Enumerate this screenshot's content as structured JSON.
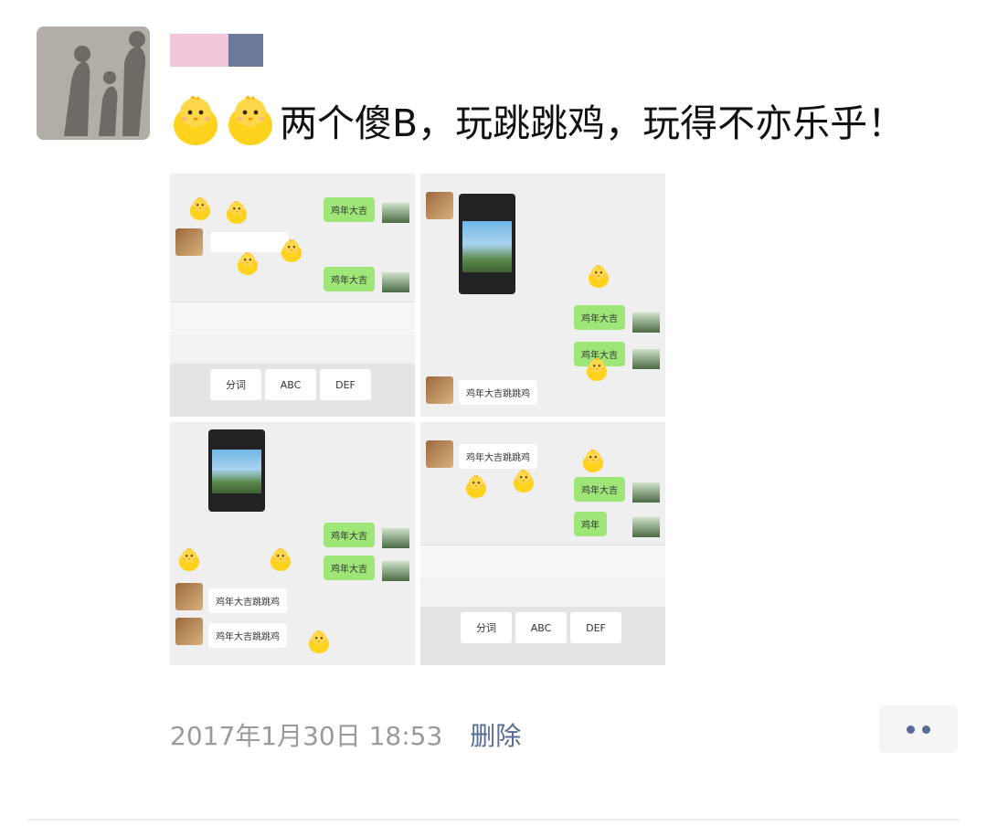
{
  "post": {
    "author_avatar_icon": "shadow-family-avatar",
    "text": "两个傻B，玩跳跳鸡，玩得不亦乐乎！",
    "leading_emoji": "chick-emoji",
    "timestamp": "2017年1月30日 18:53",
    "delete_label": "删除",
    "more_icon": "more-dots-icon"
  },
  "images": {
    "tile1": {
      "green_1": "鸡年大吉",
      "green_2": "鸡年大吉",
      "keys": [
        "分词",
        "ABC",
        "DEF"
      ]
    },
    "tile2": {
      "green_1": "鸡年大吉",
      "green_2": "鸡年大吉",
      "white_1": "鸡年大吉跳跳鸡"
    },
    "tile3": {
      "green_1": "鸡年大吉",
      "green_2": "鸡年大吉",
      "white_1": "鸡年大吉跳跳鸡",
      "white_2": "鸡年大吉跳跳鸡"
    },
    "tile4": {
      "white_1": "鸡年大吉跳跳鸡",
      "green_1": "鸡年大吉",
      "green_2": "鸡年",
      "keys": [
        "分词",
        "ABC",
        "DEF"
      ]
    }
  },
  "colors": {
    "link": "#576b95",
    "timestamp": "#9a9a9a",
    "wechat_green": "#9fe678"
  }
}
